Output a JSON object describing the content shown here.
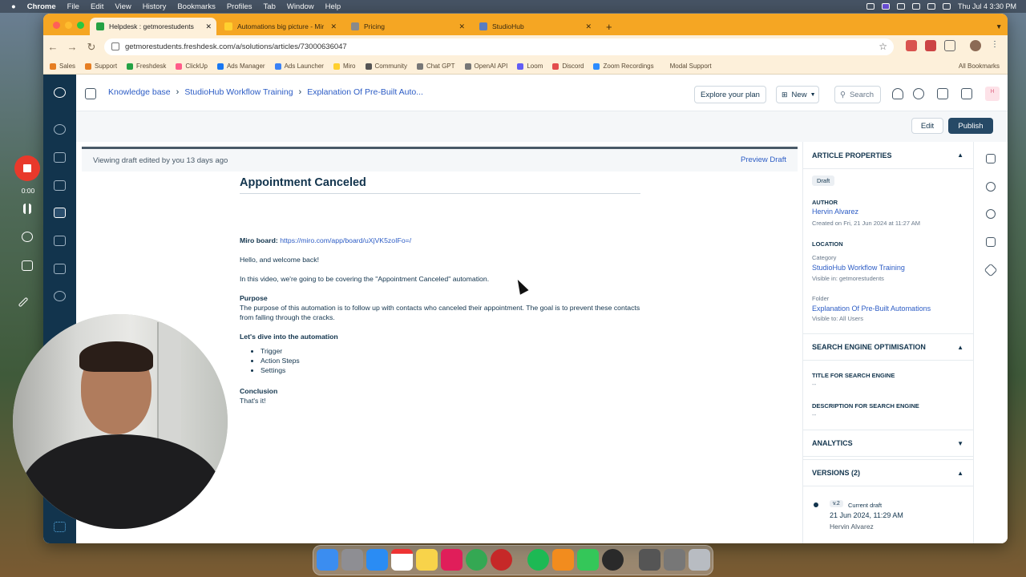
{
  "menubar": {
    "app": "Chrome",
    "items": [
      "File",
      "Edit",
      "View",
      "History",
      "Bookmarks",
      "Profiles",
      "Tab",
      "Window",
      "Help"
    ],
    "clock": "Thu Jul 4  3:30 PM"
  },
  "tabs": [
    {
      "label": "Helpdesk : getmorestudents",
      "color": "#25a244"
    },
    {
      "label": "Automations big picture - Mir",
      "color": "#ffd02f"
    },
    {
      "label": "Pricing",
      "color": "#8a8a8a"
    },
    {
      "label": "StudioHub",
      "color": "#5a7dbf"
    }
  ],
  "address": {
    "url": "getmorestudents.freshdesk.com/a/solutions/articles/73000636047"
  },
  "bookmarks": [
    "Sales",
    "Support",
    "Freshdesk",
    "ClickUp",
    "Ads Manager",
    "Ads Launcher",
    "Miro",
    "Community",
    "Chat GPT",
    "OpenAI API",
    "Loom",
    "Discord",
    "Zoom Recordings",
    "Modal Support"
  ],
  "all_bookmarks": "All Bookmarks",
  "header": {
    "breadcrumb": [
      "Knowledge base",
      "StudioHub Workflow Training",
      "Explanation Of Pre-Built Auto..."
    ],
    "explore": "Explore your plan",
    "new": "New",
    "search": "Search",
    "avatar": "H"
  },
  "actions": {
    "edit": "Edit",
    "publish": "Publish"
  },
  "editor": {
    "draft_notice": "Viewing draft edited by you 13 days ago",
    "preview": "Preview Draft",
    "title": "Appointment Canceled",
    "miro_label": "Miro board:",
    "miro_link": "https://miro.com/app/board/uXjVK5zoIFo=/",
    "greeting": "Hello, and welcome back!",
    "intro": "In this video, we're going to be covering the \"Appointment Canceled\" automation.",
    "purpose_heading": "Purpose",
    "purpose_text": "The purpose of this automation is to follow up with contacts who canceled their appointment. The goal is to prevent these contacts from falling through the cracks.",
    "dive_heading": "Let's dive into the automation",
    "bullets": [
      "Trigger",
      "Action Steps",
      "Settings"
    ],
    "conclusion_heading": "Conclusion",
    "conclusion_text": "That's it!"
  },
  "properties": {
    "heading": "ARTICLE PROPERTIES",
    "status": "Draft",
    "author_label": "AUTHOR",
    "author": "Hervin Alvarez",
    "created": "Created on Fri, 21 Jun 2024 at 11:27 AM",
    "location_label": "LOCATION",
    "category_label": "Category",
    "category": "StudioHub Workflow Training",
    "category_visible": "Visible in: getmorestudents",
    "folder_label": "Folder",
    "folder": "Explanation Of Pre-Built Automations",
    "folder_visible": "Visible to: All Users",
    "seo_heading": "SEARCH ENGINE OPTIMISATION",
    "seo_title_label": "TITLE FOR SEARCH ENGINE",
    "seo_title": "--",
    "seo_desc_label": "DESCRIPTION FOR SEARCH ENGINE",
    "seo_desc": "--",
    "analytics_heading": "ANALYTICS",
    "versions_heading": "VERSIONS (2)",
    "version_tag": "v.2",
    "version_state": "Current draft",
    "version_date": "21 Jun 2024, 11:29 AM",
    "version_author": "Hervin Alvarez"
  },
  "recorder": {
    "time": "0:00"
  }
}
